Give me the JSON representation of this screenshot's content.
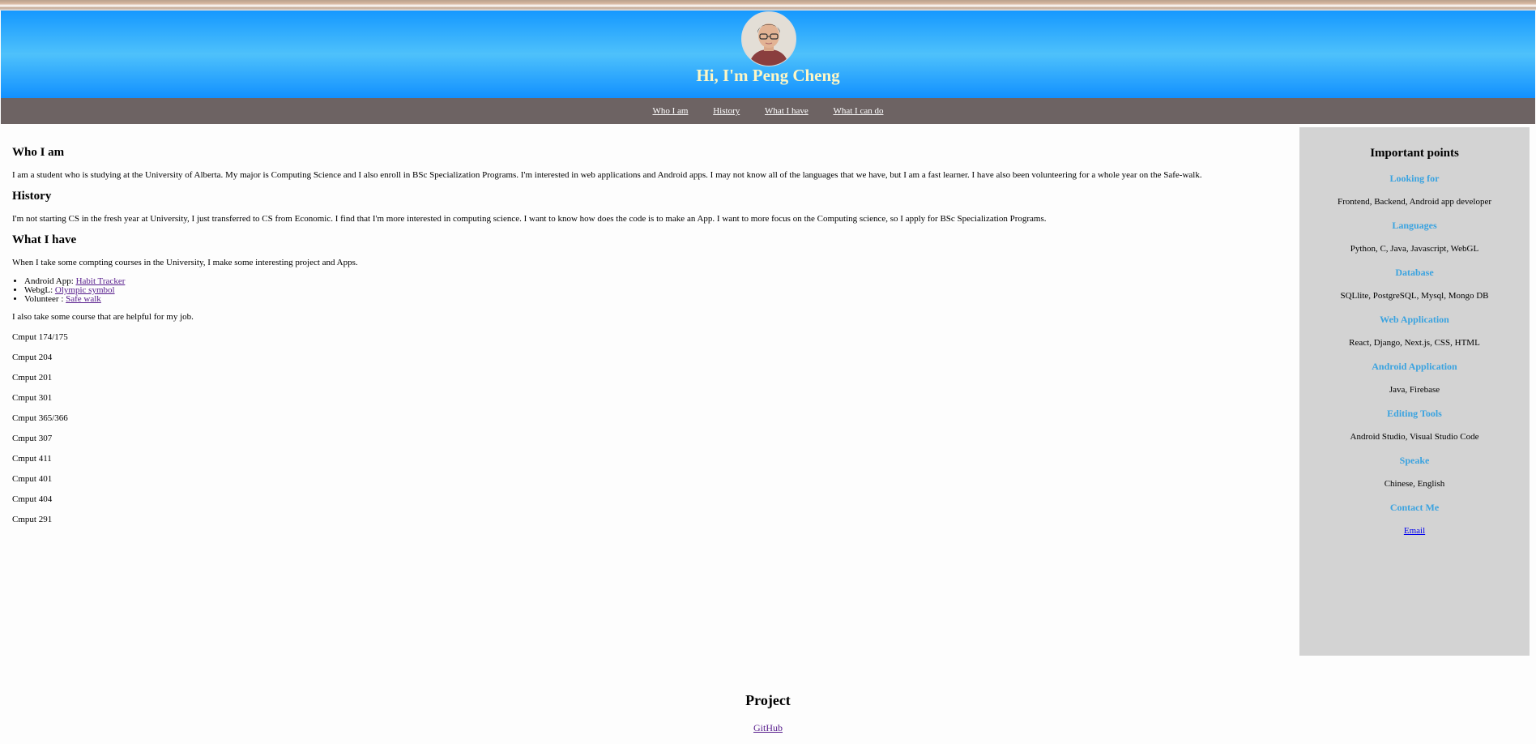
{
  "header": {
    "title": "Hi, I'm Peng Cheng"
  },
  "nav": {
    "items": [
      "Who I am",
      "History",
      "What I have",
      "What I can do"
    ]
  },
  "main": {
    "who": {
      "heading": "Who I am",
      "text": "I am a student who is studying at the University of Alberta. My major is Computing Science and I also enroll in BSc Specialization Programs. I'm interested in web applications and Android apps. I may not know all of the languages that we have, but I am a fast learner. I have also been volunteering for a whole year on the Safe-walk."
    },
    "history": {
      "heading": "History",
      "text": "I'm not starting CS in the fresh year at University, I just transferred to CS from Economic. I find that I'm more interested in computing science. I want to know how does the code is to make an App. I want to more focus on the Computing science, so I apply for BSc Specialization Programs."
    },
    "have": {
      "heading": "What I have",
      "intro": "When I take some compting courses in the University, I make some interesting project and Apps.",
      "items": [
        {
          "prefix": "Android App: ",
          "link": "Habit Tracker"
        },
        {
          "prefix": "WebgL: ",
          "link": "Olympic symbol"
        },
        {
          "prefix": "Volunteer : ",
          "link": "Safe walk"
        }
      ],
      "courses_intro": "I also take some course that are helpful for my job.",
      "courses": [
        "Cmput 174/175",
        "Cmput 204",
        "Cmput 201",
        "Cmput 301",
        "Cmput 365/366",
        "Cmput 307",
        "Cmput 411",
        "Cmput 401",
        "Cmput 404",
        "Cmput 291"
      ]
    }
  },
  "sidebar": {
    "title": "Important points",
    "sections": [
      {
        "heading": "Looking for",
        "text": "Frontend, Backend, Android app developer"
      },
      {
        "heading": "Languages",
        "text": "Python, C, Java, Javascript, WebGL"
      },
      {
        "heading": "Database",
        "text": "SQLlite, PostgreSQL, Mysql, Mongo DB"
      },
      {
        "heading": "Web Application",
        "text": "React, Django, Next.js, CSS, HTML"
      },
      {
        "heading": "Android Application",
        "text": "Java, Firebase"
      },
      {
        "heading": "Editing Tools",
        "text": "Android Studio, Visual Studio Code"
      },
      {
        "heading": "Speake",
        "text": "Chinese, English"
      }
    ],
    "contact": {
      "heading": "Contact Me",
      "link": "Email"
    }
  },
  "footer": {
    "heading": "Project",
    "link": "GitHub"
  },
  "colors": {
    "header_gradient_top": "#1598ff",
    "header_gradient_mid": "#4ec1fb",
    "nav_bg": "#6d6363",
    "title_color": "#fdf6c4",
    "sidebar_bg": "#d3d3d3",
    "sidebar_heading": "#3aa3e0"
  }
}
